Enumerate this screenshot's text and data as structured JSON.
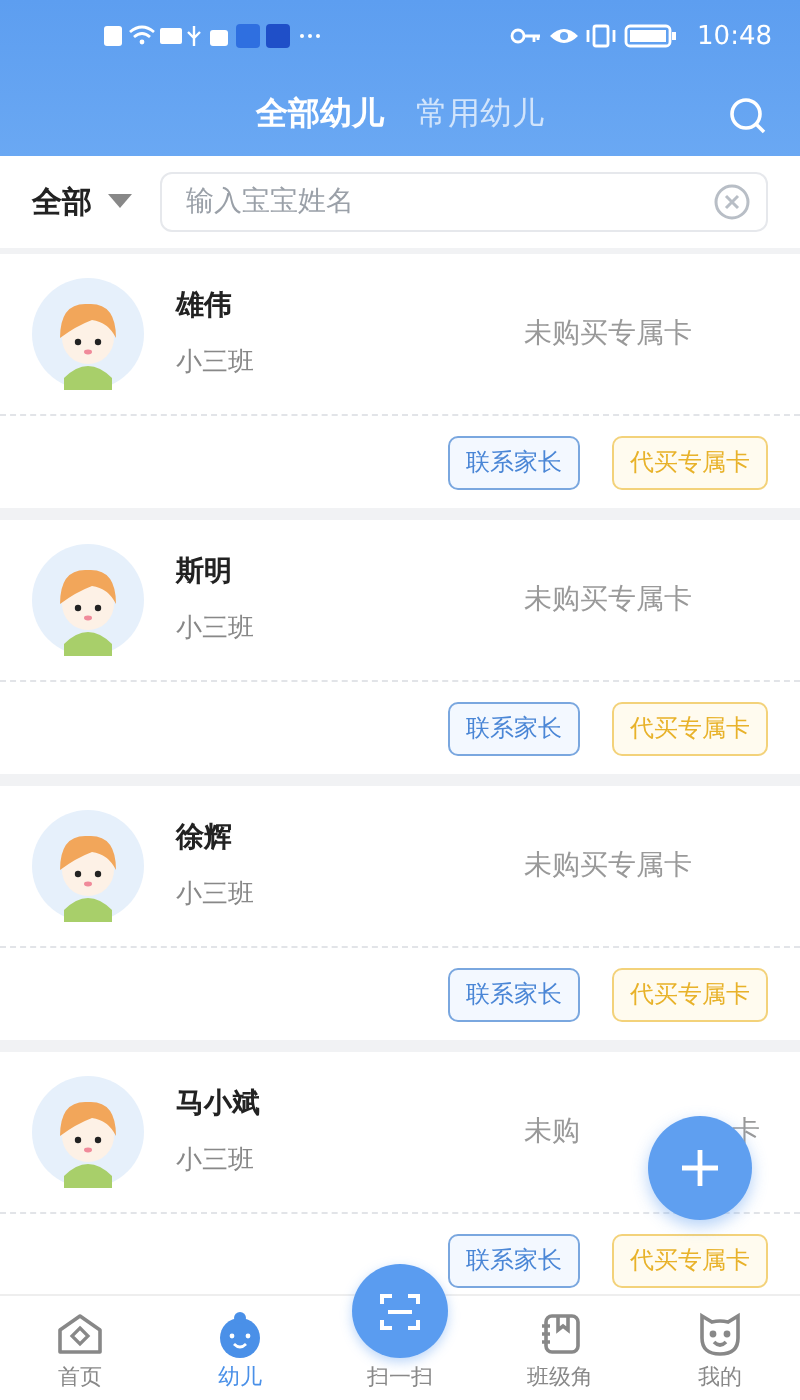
{
  "status_bar": {
    "time": "10:48"
  },
  "header": {
    "tabs": [
      {
        "label": "全部幼儿",
        "selected": true
      },
      {
        "label": "常用幼儿",
        "selected": false
      }
    ]
  },
  "filter": {
    "dropdown": "全部",
    "search": {
      "placeholder": "输入宝宝姓名"
    }
  },
  "children": [
    {
      "name": "雄伟",
      "class": "小三班",
      "status": "未购买专属卡",
      "actions": [
        {
          "label": "联系家长",
          "kind": "contact"
        },
        {
          "label": "代买专属卡",
          "kind": "buy"
        }
      ]
    },
    {
      "name": "斯明",
      "class": "小三班",
      "status": "未购买专属卡",
      "actions": [
        {
          "label": "联系家长",
          "kind": "contact"
        },
        {
          "label": "代买专属卡",
          "kind": "buy"
        }
      ]
    },
    {
      "name": "徐辉",
      "class": "小三班",
      "status": "未购买专属卡",
      "actions": [
        {
          "label": "联系家长",
          "kind": "contact"
        },
        {
          "label": "代买专属卡",
          "kind": "buy"
        }
      ]
    },
    {
      "name": "马小斌",
      "class": "小三班",
      "status": "未购",
      "status_tail": "卡",
      "actions": [
        {
          "label": "联系家长",
          "kind": "contact"
        },
        {
          "label": "代买专属卡",
          "kind": "buy"
        }
      ]
    }
  ],
  "tab_bar": {
    "items": [
      {
        "label": "首页",
        "kind": "home",
        "selected": false
      },
      {
        "label": "幼儿",
        "kind": "child",
        "selected": true
      },
      {
        "label": "扫一扫",
        "kind": "scan",
        "selected": false
      },
      {
        "label": "班级角",
        "kind": "class",
        "selected": false
      },
      {
        "label": "我的",
        "kind": "me",
        "selected": false
      }
    ]
  }
}
